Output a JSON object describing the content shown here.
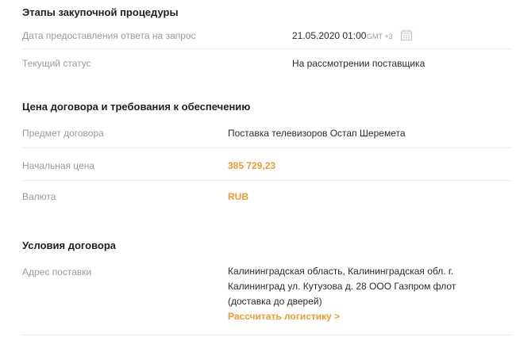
{
  "stages": {
    "title": "Этапы закупочной процедуры",
    "response_date_label": "Дата предоставления ответа на запрос",
    "response_date_value": "21.05.2020 01:00",
    "timezone": "GMT +3",
    "status_label": "Текущий статус",
    "status_value": "На рассмотрении поставщика"
  },
  "price": {
    "title": "Цена договора и требования к обеспечению",
    "subject_label": "Предмет договора",
    "subject_value": "Поставка телевизоров Остап Шеремета",
    "initial_price_label": "Начальная цена",
    "initial_price_value": "385 729,23",
    "currency_label": "Валюта",
    "currency_value": "RUB"
  },
  "conditions": {
    "title": "Условия договора",
    "address_label": "Адрес поставки",
    "address_value": "Калининградская область, Калининградская обл. г. Калининград ул. Кутузова д. 28 ООО Газпром флот (доставка до дверей)",
    "logistics_link": "Рассчитать логистику >"
  },
  "colors": {
    "accent": "#f19a2b",
    "label": "#9a9a9a",
    "divider": "#ececec"
  },
  "icons": [
    "calendar-icon"
  ]
}
